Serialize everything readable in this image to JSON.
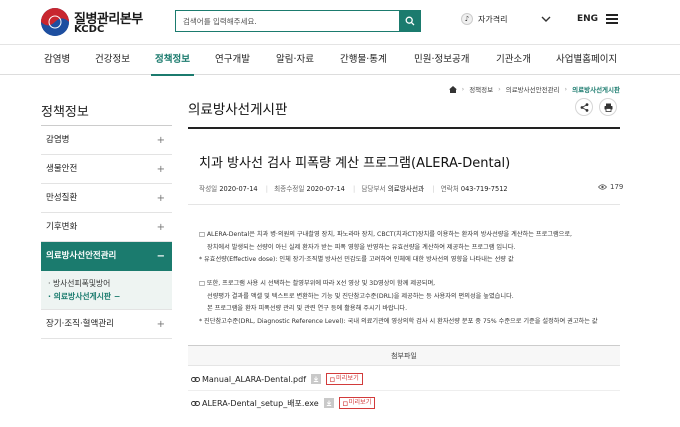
{
  "header": {
    "logo_ko": "질병관리본부",
    "logo_en": "KCDC",
    "search_placeholder": "검색어를 입력해주세요.",
    "guide_icon": "♪",
    "guide_label": "자가격리",
    "lang": "ENG"
  },
  "gnb": [
    "감염병",
    "건강정보",
    "정책정보",
    "연구개발",
    "알림·자료",
    "간행물·통계",
    "민원·정보공개",
    "기관소개",
    "사업별홈페이지"
  ],
  "sidebar": {
    "title": "정책정보",
    "items": [
      {
        "label": "감염병",
        "pm": "+"
      },
      {
        "label": "생물안전",
        "pm": "+"
      },
      {
        "label": "만성질환",
        "pm": "+"
      },
      {
        "label": "기후변화",
        "pm": "+"
      },
      {
        "label": "의료방사선안전관리",
        "pm": "−"
      }
    ],
    "sub_items": [
      "· 방사선피폭및방어",
      "· 의료방사선게시판 −"
    ],
    "last_item": {
      "label": "장기·조직·혈액관리",
      "pm": "+"
    }
  },
  "page": {
    "title": "의료방사선게시판",
    "breadcrumb": [
      "정책정보",
      "의료방사선안전관리",
      "의료방사선게시판"
    ]
  },
  "post": {
    "title": "치과 방사선 검사 피폭량 계산 프로그램(ALERA-Dental)",
    "meta": {
      "written_label": "작성일",
      "written": "2020-07-14",
      "modified_label": "최종수정일",
      "modified": "2020-07-14",
      "dept_label": "담당부서",
      "dept": "의료방사선과",
      "phone_label": "연락처",
      "phone": "043-719-7512"
    },
    "views": "179",
    "body": {
      "p1_line1": "□ ALERA-Dental은 치과 병·의원의 구내촬영 장치, 파노라마 장치, CBCT(치과CT)장치를 이용하는 환자의 방사선량을 계산하는 프로그램으로,",
      "p1_line2": "장치에서 발생되는 선량이 아닌 실제 환자가 받는 피폭 영향을 반영하는 유효선량을 계산하여 제공하는 프로그램 입니다.",
      "p1_note": "* 유효선량(Effective dose): 인체 장기·조직별 방사선 민감도를 고려하여 인체에 대한 방사선의 영향을 나타내는 선량 값",
      "p2_line1": "□ 또한, 프로그램 사용 시 선택하는 촬영부위에 따라 X선 영상 및 3D영상이 함께 제공되며,",
      "p2_line2": "선량평가 결과를 액셀 및 텍스트로 변환하는 기능 및 진단참고수준(DRL)을 제공하는 등 사용자의 편의성을 높였습니다.",
      "p2_line3": "본 프로그램을 환자 피폭선량 관리 및 관련 연구 등에 활용해 주시기 바랍니다.",
      "p2_note": "* 진단참고수준(DRL, Diagnostic Reference Level): 국내 의료기관에 영상의학 검사 시 환자선량 분포 중 75% 수준으로 기준을 설정하여 권고하는 값"
    },
    "attach_header": "첨부파일",
    "files": [
      {
        "name": "Manual_ALARA-Dental.pdf",
        "preview": "미리보기"
      },
      {
        "name": "ALERA-Dental_setup_배포.exe",
        "preview": "미리보기"
      }
    ]
  },
  "colors": {
    "accent": "#1b7b6e",
    "logo_red": "#c8262f",
    "logo_blue": "#1e4fa0",
    "preview_red": "#d23b3b"
  }
}
